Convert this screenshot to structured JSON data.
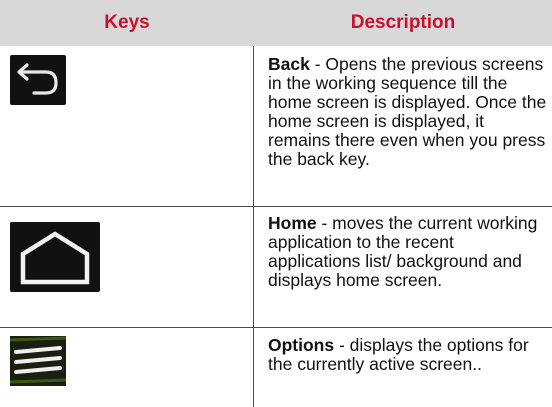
{
  "header": {
    "keys": "Keys",
    "description": "Description"
  },
  "rows": [
    {
      "icon": "back-arrow-icon",
      "title": "Back",
      "text": " - Opens the previous screens in the working sequence till the home screen is displayed. Once the home screen is displayed, it remains there even when you press the back key."
    },
    {
      "icon": "home-icon",
      "title": "Home",
      "text": " - moves the current working application to the recent applications list/ background and displays home screen."
    },
    {
      "icon": "menu-lines-icon",
      "title": "Options",
      "text": " - displays the options for the currently active screen.."
    }
  ],
  "colors": {
    "header_text": "#c8102e",
    "header_bg": "#d8d8d8",
    "grid": "#4d4d4d",
    "icon_bg": "#111111",
    "icon_green": "#3a5a12"
  }
}
